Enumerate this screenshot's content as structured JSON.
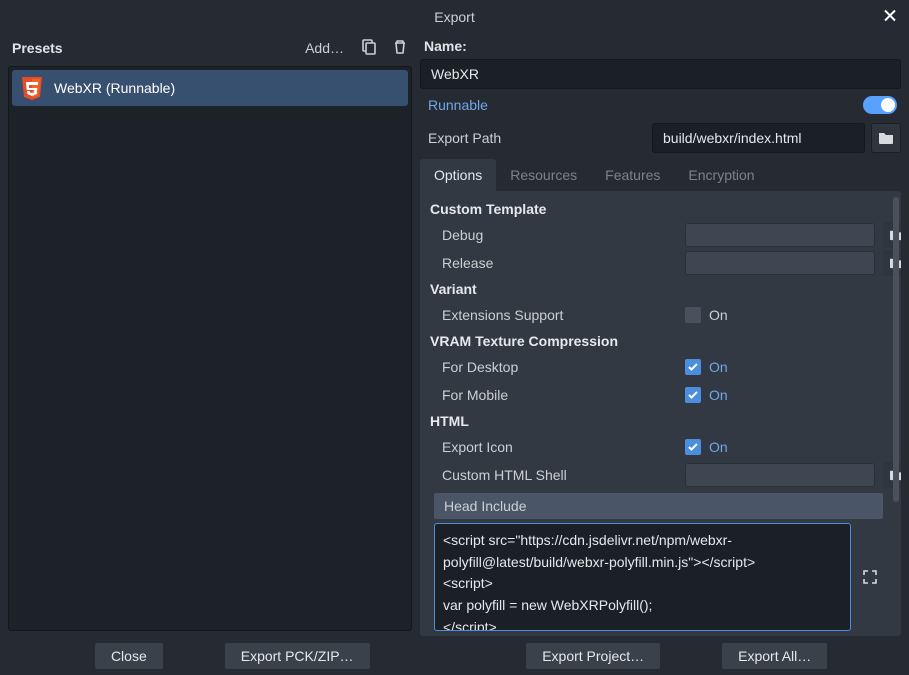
{
  "window": {
    "title": "Export"
  },
  "presets": {
    "header": "Presets",
    "add": "Add…",
    "items": [
      {
        "label": "WebXR (Runnable)"
      }
    ]
  },
  "name": {
    "label": "Name:",
    "value": "WebXR"
  },
  "runnable": {
    "label": "Runnable",
    "on": true
  },
  "export_path": {
    "label": "Export Path",
    "value": "build/webxr/index.html"
  },
  "tabs": [
    "Options",
    "Resources",
    "Features",
    "Encryption"
  ],
  "sections": {
    "custom_template": {
      "title": "Custom Template",
      "debug": {
        "label": "Debug",
        "value": ""
      },
      "release": {
        "label": "Release",
        "value": ""
      }
    },
    "variant": {
      "title": "Variant",
      "extensions": {
        "label": "Extensions Support",
        "on": false,
        "text": "On"
      }
    },
    "vram": {
      "title": "VRAM Texture Compression",
      "desktop": {
        "label": "For Desktop",
        "on": true,
        "text": "On"
      },
      "mobile": {
        "label": "For Mobile",
        "on": true,
        "text": "On"
      }
    },
    "html": {
      "title": "HTML",
      "export_icon": {
        "label": "Export Icon",
        "on": true,
        "text": "On"
      },
      "custom_shell": {
        "label": "Custom HTML Shell",
        "value": ""
      },
      "head_include": {
        "label": "Head Include",
        "value": "<script src=\"https://cdn.jsdelivr.net/npm/webxr-polyfill@latest/build/webxr-polyfill.min.js\"></script>\n<script>\nvar polyfill = new WebXRPolyfill();\n</script>"
      }
    }
  },
  "footer": {
    "close": "Close",
    "export_pck": "Export PCK/ZIP…",
    "export_project": "Export Project…",
    "export_all": "Export All…"
  }
}
